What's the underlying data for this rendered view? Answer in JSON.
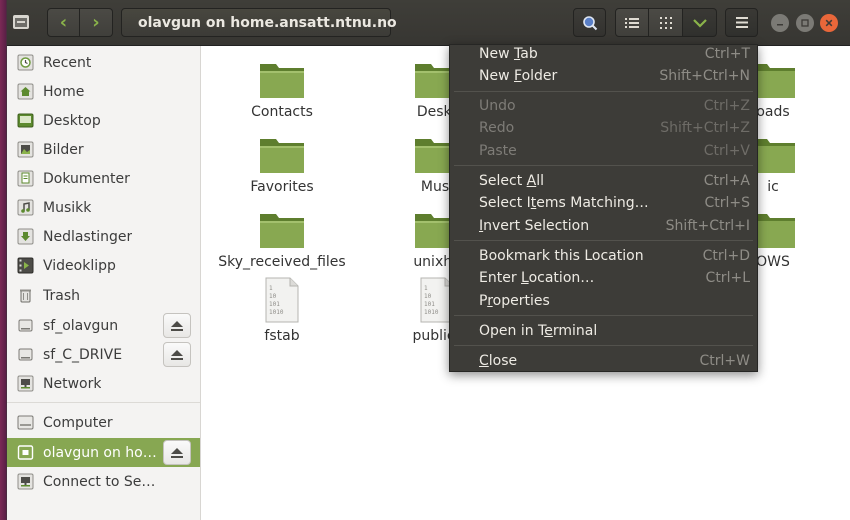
{
  "header": {
    "path_label": "olavgun on home.ansatt.ntnu.no"
  },
  "sidebar": {
    "items": [
      {
        "label": "Recent",
        "icon": "clock-icon"
      },
      {
        "label": "Home",
        "icon": "home-icon"
      },
      {
        "label": "Desktop",
        "icon": "desktop-icon"
      },
      {
        "label": "Bilder",
        "icon": "pictures-icon"
      },
      {
        "label": "Dokumenter",
        "icon": "documents-icon"
      },
      {
        "label": "Musikk",
        "icon": "music-icon"
      },
      {
        "label": "Nedlastinger",
        "icon": "downloads-icon"
      },
      {
        "label": "Videoklipp",
        "icon": "videos-icon"
      },
      {
        "label": "Trash",
        "icon": "trash-icon"
      },
      {
        "label": "sf_olavgun",
        "icon": "drive-icon"
      },
      {
        "label": "sf_C_DRIVE",
        "icon": "drive-icon"
      },
      {
        "label": "Network",
        "icon": "network-icon"
      },
      {
        "label": "Computer",
        "icon": "computer-icon"
      },
      {
        "label": "olavgun on ho…",
        "icon": "network-share-icon"
      },
      {
        "label": "Connect to Server",
        "icon": "connect-server-icon"
      }
    ]
  },
  "files": [
    {
      "label": "Contacts",
      "type": "folder"
    },
    {
      "label": "Deskt",
      "type": "folder"
    },
    {
      "label": "oads",
      "type": "folder"
    },
    {
      "label": "Favorites",
      "type": "folder"
    },
    {
      "label": "Musi",
      "type": "folder"
    },
    {
      "label": "ic",
      "type": "folder"
    },
    {
      "label": "Sky_received_files",
      "type": "folder"
    },
    {
      "label": "unixho",
      "type": "folder"
    },
    {
      "label": "OWS",
      "type": "folder"
    },
    {
      "label": "fstab",
      "type": "text-file"
    },
    {
      "label": "public_",
      "type": "text-file"
    }
  ],
  "menu": {
    "new_tab": {
      "pre": "New ",
      "u": "T",
      "post": "ab",
      "shortcut": "Ctrl+T"
    },
    "new_folder": {
      "pre": "New ",
      "u": "F",
      "post": "older",
      "shortcut": "Shift+Ctrl+N"
    },
    "undo": {
      "label": "Undo",
      "shortcut": "Ctrl+Z"
    },
    "redo": {
      "label": "Redo",
      "shortcut": "Shift+Ctrl+Z"
    },
    "paste": {
      "label": "Paste",
      "shortcut": "Ctrl+V"
    },
    "select_all": {
      "pre": "Select ",
      "u": "A",
      "post": "ll",
      "shortcut": "Ctrl+A"
    },
    "select_matching": {
      "pre": "Select I",
      "u": "t",
      "post": "ems Matching…",
      "shortcut": "Ctrl+S"
    },
    "invert_selection": {
      "pre": "",
      "u": "I",
      "post": "nvert Selection",
      "shortcut": "Shift+Ctrl+I"
    },
    "bookmark": {
      "label": "Bookmark this Location",
      "shortcut": "Ctrl+D"
    },
    "enter_location": {
      "pre": "Enter ",
      "u": "L",
      "post": "ocation…",
      "shortcut": "Ctrl+L"
    },
    "properties": {
      "pre": "P",
      "u": "r",
      "post": "operties",
      "shortcut": ""
    },
    "open_terminal": {
      "pre": "Open in T",
      "u": "e",
      "post": "rminal",
      "shortcut": ""
    },
    "close": {
      "pre": "",
      "u": "C",
      "post": "lose",
      "shortcut": "Ctrl+W"
    }
  },
  "colors": {
    "accent": "#87a752",
    "header_bg": "#3c3b37",
    "menu_bg": "#3d3c38",
    "close_button": "#e9673a"
  }
}
